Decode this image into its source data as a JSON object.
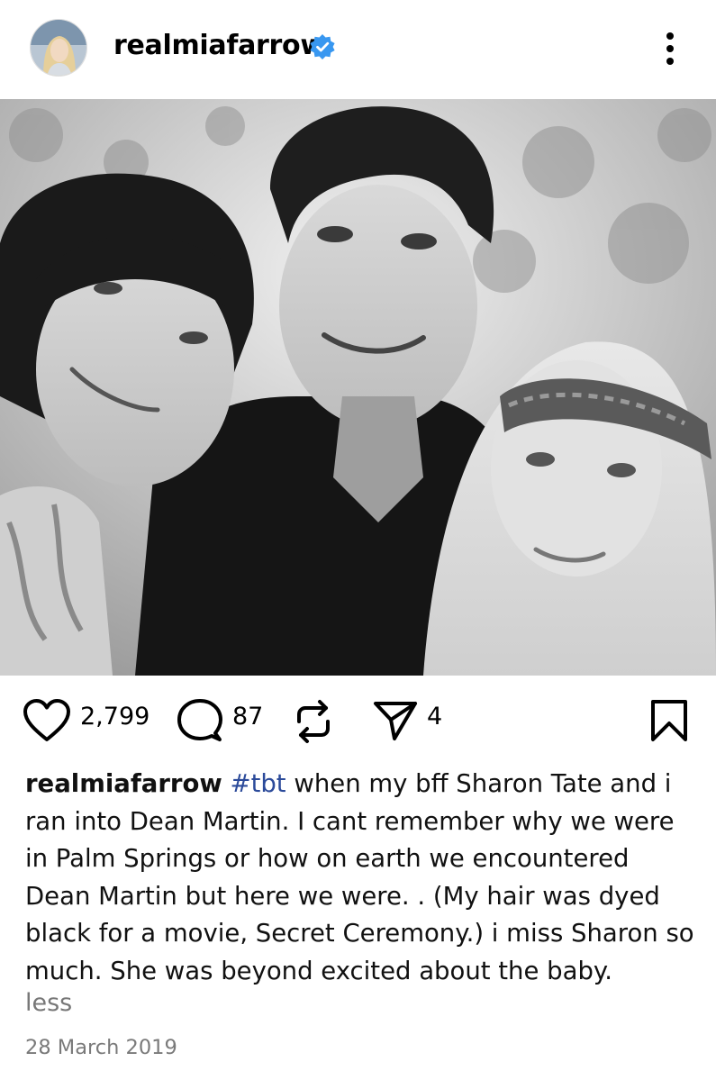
{
  "post": {
    "username": "realmiafarrow",
    "verified": true,
    "photo_alt_icon": "photo-image",
    "likes": "2,799",
    "comments": "87",
    "shares": "4",
    "caption_user": "realmiafarrow",
    "hashtag": "#tbt",
    "caption_text": " when my bff Sharon Tate and i ran into Dean Martin. I cant remember why we were in Palm Springs or how on earth we encountered Dean Martin but here we were. . (My hair was dyed black for a movie, Secret Ceremony.) i miss Sharon so much. She was beyond excited about the baby.",
    "less_label": "less",
    "date": "28 March 2019"
  },
  "colors": {
    "verified_badge": "#3897f0",
    "hashtag": "#2b4a9a",
    "muted_text": "#777777"
  },
  "icons": [
    "heart-icon",
    "comment-icon",
    "repost-icon",
    "share-icon",
    "bookmark-icon",
    "more-options-icon",
    "verified-badge-icon"
  ]
}
